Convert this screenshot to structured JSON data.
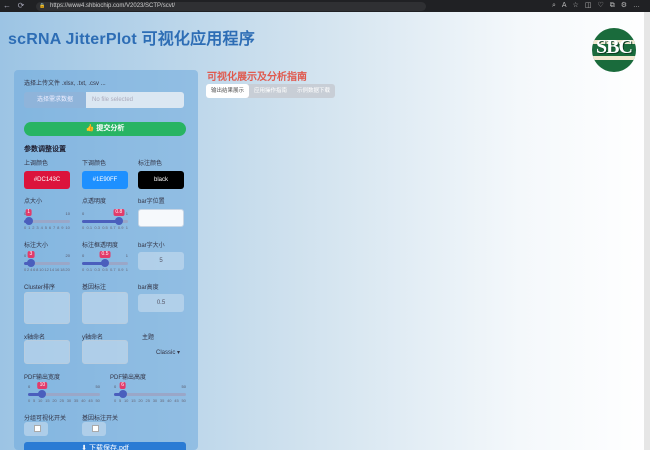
{
  "browser": {
    "url": "https://www4.shbiochip.com/V2023/SCTP/scvt/",
    "nav": [
      "←",
      "⟳"
    ],
    "icons": [
      "⌕",
      "A",
      "☆",
      "◫",
      "♡",
      "⧉",
      "⚙",
      "…"
    ]
  },
  "app": {
    "title": "scRNA JitterPlot 可视化应用程序",
    "logo_text": "SBC"
  },
  "sidebar": {
    "upload_label": "选择上传文件 .xlsx, .txt, .csv ...",
    "browse_label": "选择需求数据",
    "file_placeholder": "No file selected",
    "submit_label": "👍 提交分析",
    "section_title": "参数调整设置",
    "colors": [
      {
        "label": "上调颜色",
        "value": "#DC143C",
        "bg": "#DC143C",
        "fg": "#ffffff"
      },
      {
        "label": "下调颜色",
        "value": "#1E90FF",
        "bg": "#1E90FF",
        "fg": "#ffffff"
      },
      {
        "label": "标注颜色",
        "value": "black",
        "bg": "#000000",
        "fg": "#ffffff"
      }
    ],
    "row2": {
      "point_size_label": "点大小",
      "point_size": {
        "value": 1,
        "min": 0,
        "max": 10,
        "fraction": 0.1,
        "ticks": [
          "0",
          "1",
          "2",
          "3",
          "4",
          "5",
          "6",
          "7",
          "8",
          "9",
          "10"
        ]
      },
      "point_alpha_label": "点透明度",
      "point_alpha": {
        "value": 0.8,
        "min": 0,
        "max": 1,
        "fraction": 0.8,
        "ticks": [
          "0",
          "0.1",
          "0.3",
          "0.5",
          "0.7",
          "0.9",
          "1"
        ]
      },
      "bar_top_label": "bar字位置",
      "bar_top_value": ""
    },
    "row3": {
      "label_size_label": "标注大小",
      "label_size": {
        "value": 3,
        "min": 0,
        "max": 20,
        "fraction": 0.15,
        "ticks": [
          "0",
          "2",
          "4",
          "6",
          "8",
          "10",
          "12",
          "14",
          "16",
          "18",
          "20"
        ]
      },
      "label_alpha_label": "标注框透明度",
      "label_alpha": {
        "value": 0.5,
        "min": 0,
        "max": 1,
        "fraction": 0.5,
        "ticks": [
          "0",
          "0.1",
          "0.3",
          "0.5",
          "0.7",
          "0.9",
          "1"
        ]
      },
      "bar_size_label": "bar字大小",
      "bar_size_value": "5"
    },
    "row4": {
      "cluster_label": "Cluster排序",
      "gene_label": "基因标注",
      "bar_height_label": "bar高度",
      "bar_height_value": "0.5"
    },
    "row5": {
      "x_label": "x轴命名",
      "y_label": "y轴命名",
      "theme_label": "主题",
      "theme_value": "Classic"
    },
    "pdf": {
      "width_label": "PDF输出宽度",
      "width": {
        "value": 10,
        "min": 0,
        "max": 50,
        "fraction": 0.2,
        "ticks": [
          "0",
          "5",
          "10",
          "15",
          "20",
          "25",
          "30",
          "35",
          "40",
          "45",
          "50"
        ]
      },
      "height_label": "PDF输出高度",
      "height": {
        "value": 6,
        "min": 0,
        "max": 50,
        "fraction": 0.12,
        "ticks": [
          "0",
          "5",
          "10",
          "15",
          "20",
          "25",
          "30",
          "35",
          "40",
          "45",
          "50"
        ]
      }
    },
    "check1_label": "分组可视化开关",
    "check2_label": "基因标注开关",
    "download_label": "⬇ 下载保存.pdf"
  },
  "main": {
    "title": "可视化展示及分析指南",
    "tabs": [
      {
        "label": "输出结果展示",
        "active": true
      },
      {
        "label": "应用操作指南",
        "active": false
      },
      {
        "label": "示例数据下载",
        "active": false
      }
    ]
  }
}
